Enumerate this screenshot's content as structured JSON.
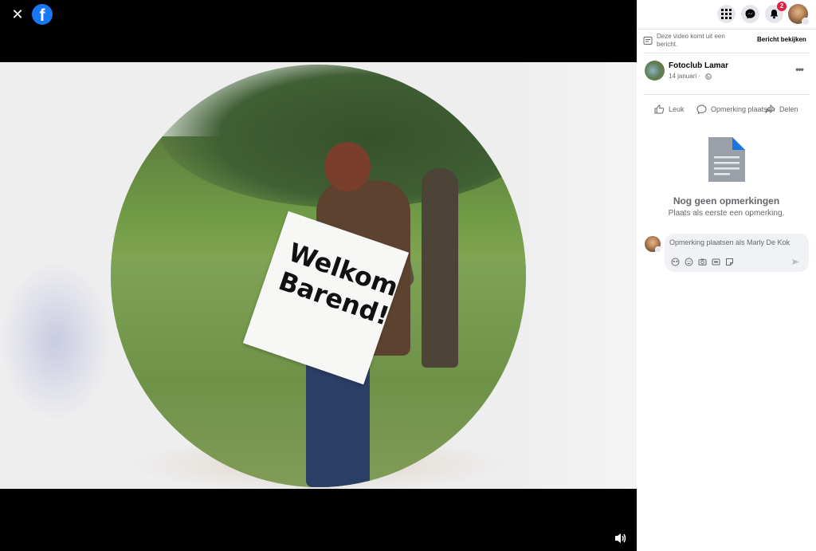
{
  "viewer": {
    "close_icon": "close-icon",
    "logo": "facebook-logo"
  },
  "video": {
    "sign_line1": "Welkom",
    "sign_line2": "Barend!",
    "mute_icon": "volume-icon"
  },
  "topnav": {
    "menu_icon": "grid-menu-icon",
    "messenger_icon": "messenger-icon",
    "notifications_icon": "bell-icon",
    "notifications_count": "2"
  },
  "message_bar": {
    "text": "Deze video komt uit een bericht.",
    "link": "Bericht bekijken"
  },
  "post": {
    "page_name": "Fotoclub Lamar",
    "date": "14 januari ·",
    "privacy_icon": "globe-icon"
  },
  "actions": {
    "like": "Leuk",
    "comment": "Opmerking plaatsen",
    "share": "Delen"
  },
  "comments": {
    "empty_title": "Nog geen opmerkingen",
    "empty_subtitle": "Plaats als eerste een opmerking.",
    "composer_placeholder": "Opmerking plaatsen als Marly De Kok"
  },
  "colors": {
    "brand": "#1877f2",
    "badge": "#e41e3f",
    "doc_icon": "#5b8fe8"
  }
}
